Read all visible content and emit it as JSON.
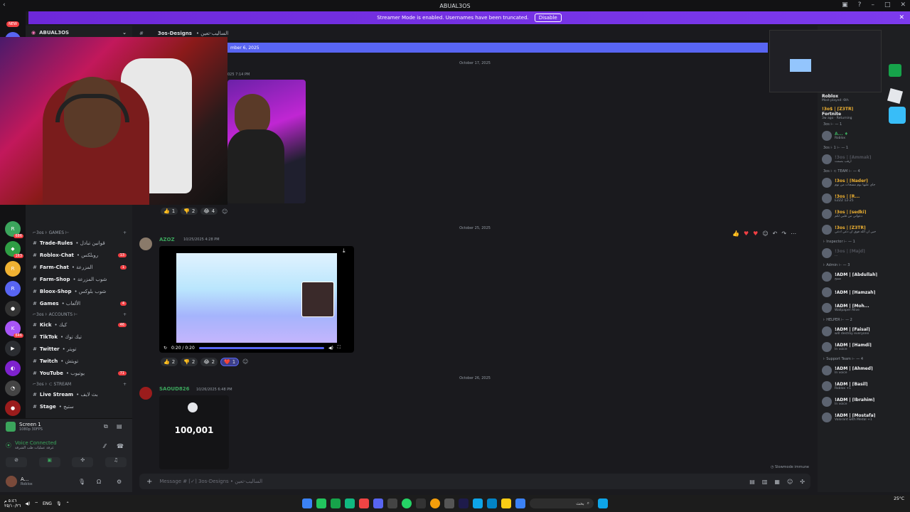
{
  "titlebar": {
    "title": "ABUAL3OS"
  },
  "streamer": {
    "text": "Streamer Mode is enabled. Usernames have been truncated.",
    "disable": "Disable"
  },
  "guilds": {
    "new_badge": "NEW"
  },
  "server": {
    "name": "ABUAL3OS",
    "category_games": "⌐3os ⊦ GAMES ⊢",
    "category_accounts": "⌐3os ⊦ ACCOUNTS ⊢",
    "category_stream": "⌐3os ⊦ ⊂ STREAM",
    "channels_games": [
      {
        "label": "Trade-Rules",
        "ar": "• قوانين تبادل",
        "count": ""
      },
      {
        "label": "Roblox-Chat",
        "ar": "• روبلكس",
        "count": "13"
      },
      {
        "label": "Farm-Chat",
        "ar": "• المزرعة",
        "count": "1"
      },
      {
        "label": "Farm-Shop",
        "ar": "• شوب المزرعة",
        "count": ""
      },
      {
        "label": "Bloox-Shop",
        "ar": "• شوب بلوكس",
        "count": ""
      },
      {
        "label": "Games",
        "ar": "• الألعاب",
        "count": "4"
      }
    ],
    "channels_accounts": [
      {
        "label": "Kick",
        "ar": "• كيك",
        "count": "46"
      },
      {
        "label": "TikTok",
        "ar": "• تيك توك",
        "count": ""
      },
      {
        "label": "Twitter",
        "ar": "• تويتر",
        "count": ""
      },
      {
        "label": "Twitch",
        "ar": "• تويتش",
        "count": ""
      },
      {
        "label": "YouTube",
        "ar": "• يوتيوب",
        "count": "71"
      }
    ],
    "channels_stream": [
      {
        "label": "Live Stream",
        "ar": "• بث لايف"
      },
      {
        "label": "Stage",
        "ar": "• ستيج"
      }
    ]
  },
  "user_panel": {
    "screen_title": "Screen 1",
    "screen_sub": "1080p 30FPS",
    "voice_connected": "Voice Connected",
    "voice_sub": "غرفة عمليات طب الشرقة",
    "user_name": "A...",
    "user_status": "Roblox"
  },
  "chat": {
    "channel_name": "3os-Designs",
    "channel_ar": "• الساليب-تعين",
    "new_messages_bar": "mber 6, 2025",
    "divider_1": "October 17, 2025",
    "msg1_ts": "025 7:14 PM",
    "divider_2": "October 25, 2025",
    "msg2_author": "AZOZ",
    "msg2_ts": "10/25/2025 4:28 PM",
    "video_time": "0:20 / 0:20",
    "divider_3": "October 26, 2025",
    "msg3_author": "SAOUD826",
    "msg3_ts": "10/26/2025 6:48 PM",
    "msg3_image_value": "100,001",
    "reactions_1": [
      {
        "emoji": "👍",
        "count": "1"
      },
      {
        "emoji": "👎",
        "count": "2"
      },
      {
        "emoji": "😂",
        "count": "4"
      }
    ],
    "reactions_2": [
      {
        "emoji": "👍",
        "count": "2"
      },
      {
        "emoji": "👎",
        "count": "2"
      },
      {
        "emoji": "😂",
        "count": "2"
      },
      {
        "emoji": "❤️",
        "count": "1"
      }
    ],
    "slowmode": "Slowmode immune",
    "composer_placeholder": "Message # ⌈✓⌉ 3os-Designs • الساليب-تعين"
  },
  "members": {
    "activity_1_name": "Roblox",
    "activity_1_sub": "Most played: 6th",
    "activity_2_user": "!3ο$ | ⌈Z3TR⌉",
    "activity_2_name": "Fortnite",
    "activity_2_sub": "3w ago · Returning",
    "groups": [
      {
        "title": "3os ⊢ — 1",
        "members": [
          {
            "name": "A... ♦",
            "status": "Roblox",
            "color": "#3ba55c"
          }
        ]
      },
      {
        "title": "3os ⊦ 1 ⊢ — 1",
        "members": [
          {
            "name": "!3οs | ⌈Ammak⌉",
            "status": "ارقب بصمت",
            "color": "#4e5058"
          }
        ]
      },
      {
        "title": "3os ⊦ ⊂ TEAM ⊢ — 4",
        "members": [
          {
            "name": "!3οs | ⌈Nader⌉",
            "status": "جاي عليها بوم مسجات من نوم",
            "color": "#f0b232"
          },
          {
            "name": "!3οs | ⌈R...",
            "status": "EZZZ 12-25",
            "color": "#f0b232"
          },
          {
            "name": "!3οs | ⌈sedki⌉",
            "status": "دعواتي من قلبي لكم",
            "color": "#f0b232"
          },
          {
            "name": "!3οs | ⌈Z3TR⌉",
            "status": "حبي ان الله فوق ان دعي ادعي",
            "color": "#f0b232"
          }
        ]
      },
      {
        "title": "⊦ Inspector ⊢ — 1",
        "members": [
          {
            "name": "!3οs | ⌈Majd⌉",
            "status": "...",
            "color": "#4e5058"
          }
        ]
      },
      {
        "title": "⊦ Admin ⊢ — 3",
        "members": [
          {
            "name": "!ADM | ⌈Abdullah⌉",
            "status": "مسح",
            "color": "#f2f3f5"
          },
          {
            "name": "!ADM | ⌈Hamzah⌉",
            "status": "",
            "color": "#f2f3f5"
          },
          {
            "name": "!ADM | ⌈Moh...",
            "status": "Wallpaper Alive",
            "color": "#f2f3f5"
          }
        ]
      },
      {
        "title": "⊦ HELPER ⊢ — 2",
        "members": [
          {
            "name": "!ADM | ⌈Faisal⌉",
            "status": "will destroy everyone",
            "color": "#f2f3f5"
          },
          {
            "name": "!ADM | ⌈Hamdi⌉",
            "status": "In voice",
            "color": "#f2f3f5"
          }
        ]
      },
      {
        "title": "⊦ Support Team ⊢ — 4",
        "members": [
          {
            "name": "!ADM | ⌈Ahmed⌉",
            "status": "In voice",
            "color": "#f2f3f5"
          },
          {
            "name": "!ADM | ⌈Basil⌉",
            "status": "Roblox +1",
            "color": "#f2f3f5"
          },
          {
            "name": "!ADM | ⌈Ibrahim⌉",
            "status": "In voice",
            "color": "#f2f3f5"
          },
          {
            "name": "!ADM | ⌈Mostafa⌉",
            "status": "Valorant with Medal +1",
            "color": "#f2f3f5"
          }
        ]
      }
    ]
  },
  "taskbar": {
    "lang": "ENG",
    "time": "٥:٤٦ م",
    "date": "٢٥/١٠/٢٦",
    "weather": "25°C",
    "search": "بحث"
  }
}
